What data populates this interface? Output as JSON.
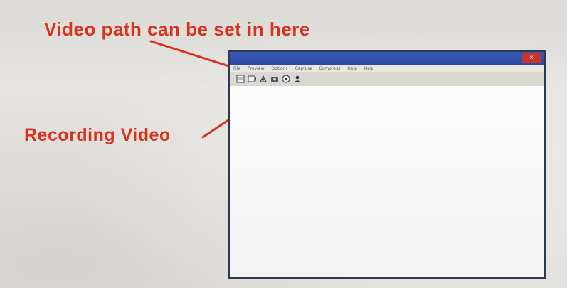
{
  "slide": {
    "top_text": "",
    "annotation_path": "Video path can be set in here",
    "annotation_recording": "Recording Video",
    "accent_color": "#d8321c"
  },
  "window": {
    "title": "",
    "close_symbol": "×",
    "menu": [
      "File",
      "Preview",
      "Options",
      "Capture",
      "Compress",
      "Help",
      "Help"
    ],
    "toolbar_icons": [
      "settings-path-icon",
      "preview-icon",
      "record-icon",
      "camera-icon",
      "stop-icon",
      "user-icon"
    ],
    "colors": {
      "titlebar": "#2a4aa6",
      "border": "#2e3a52",
      "close": "#c8342c"
    }
  }
}
